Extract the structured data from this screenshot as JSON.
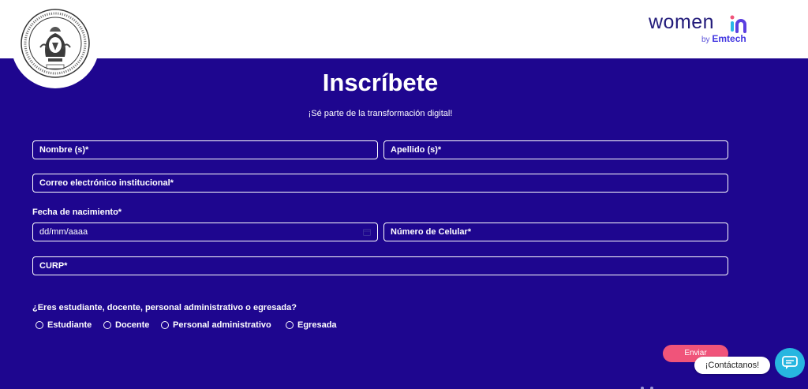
{
  "header": {
    "brand_word": "women",
    "brand_by": "by",
    "brand_company": "Emtech"
  },
  "form": {
    "title": "Inscríbete",
    "subtitle": "¡Sé parte de la transformación digital!",
    "fields": {
      "nombre": "Nombre (s)*",
      "apellido": "Apellido (s)*",
      "correo": "Correo electrónico institucional*",
      "fecha_label": "Fecha de nacimiento*",
      "fecha_placeholder": "dd/mm/aaaa",
      "celular": "Número de Celular*",
      "curp": "CURP*"
    },
    "role_question": "¿Eres estudiante, docente, personal administrativo o egresada?",
    "role_options": [
      "Estudiante",
      "Docente",
      "Personal administrativo",
      "Egresada"
    ],
    "submit_label": "Enviar"
  },
  "chat": {
    "bubble_label": "¡Contáctanos!",
    "icon": "chat-icon"
  },
  "colors": {
    "background": "#1e068f",
    "accent": "#f0547a",
    "chat": "#27b6e0",
    "brand": "#221b7a"
  }
}
